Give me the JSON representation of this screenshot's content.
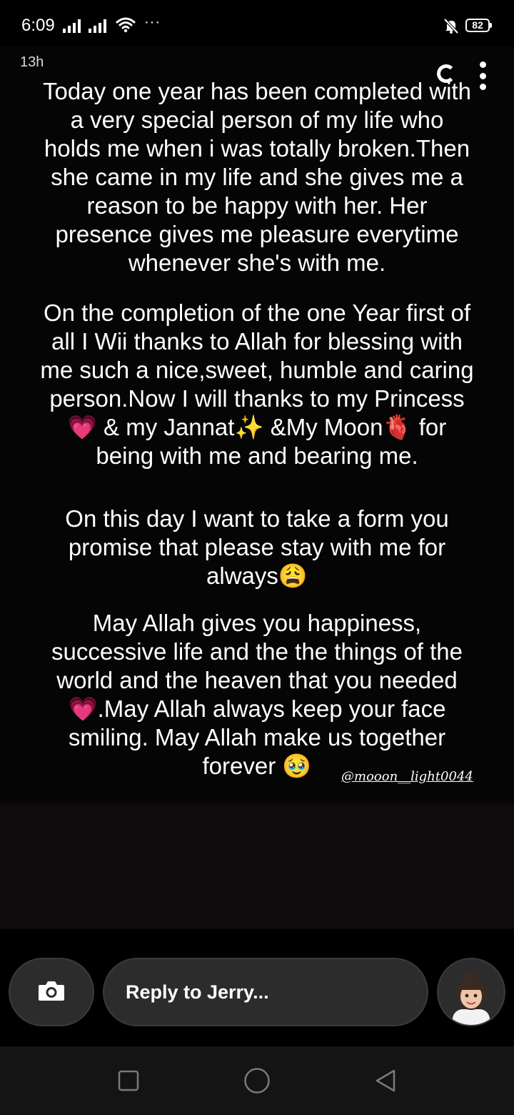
{
  "status_bar": {
    "time": "6:09",
    "battery": "82",
    "more_indicator": "···",
    "icons": [
      "signal-icon",
      "signal-icon",
      "wifi-icon",
      "do-not-disturb-icon",
      "battery-icon"
    ]
  },
  "story": {
    "timestamp": "13h",
    "paragraphs": [
      "Today one year has been completed with\na very special person of my life who\nholds me when i was totally broken.Then\nshe came in my life and she gives me a\nreason to be happy with her. Her\npresence gives me pleasure everytime\nwhenever she's with me.",
      "On the completion of the one Year first of\nall I Wii thanks to Allah for blessing with\nme such a nice,sweet, humble and caring\nperson.Now I will thanks to my Princess\n💗 & my Jannat✨ &My Moon🫀 for\nbeing with me and bearing me.",
      "On this day I want to take a form you\npromise that please stay with me for\nalways😩",
      "May Allah gives you happiness,\nsuccessive life and the the things of the\nworld and the heaven that you needed\n💗.May Allah always keep your face\nsmiling. May Allah make us together\nforever 🥹"
    ],
    "watermark": "@mooon__light0044"
  },
  "reply": {
    "placeholder": "Reply to Jerry..."
  },
  "colors": {
    "background": "#000000",
    "pill": "#2c2c2c",
    "navbar": "#141414"
  }
}
